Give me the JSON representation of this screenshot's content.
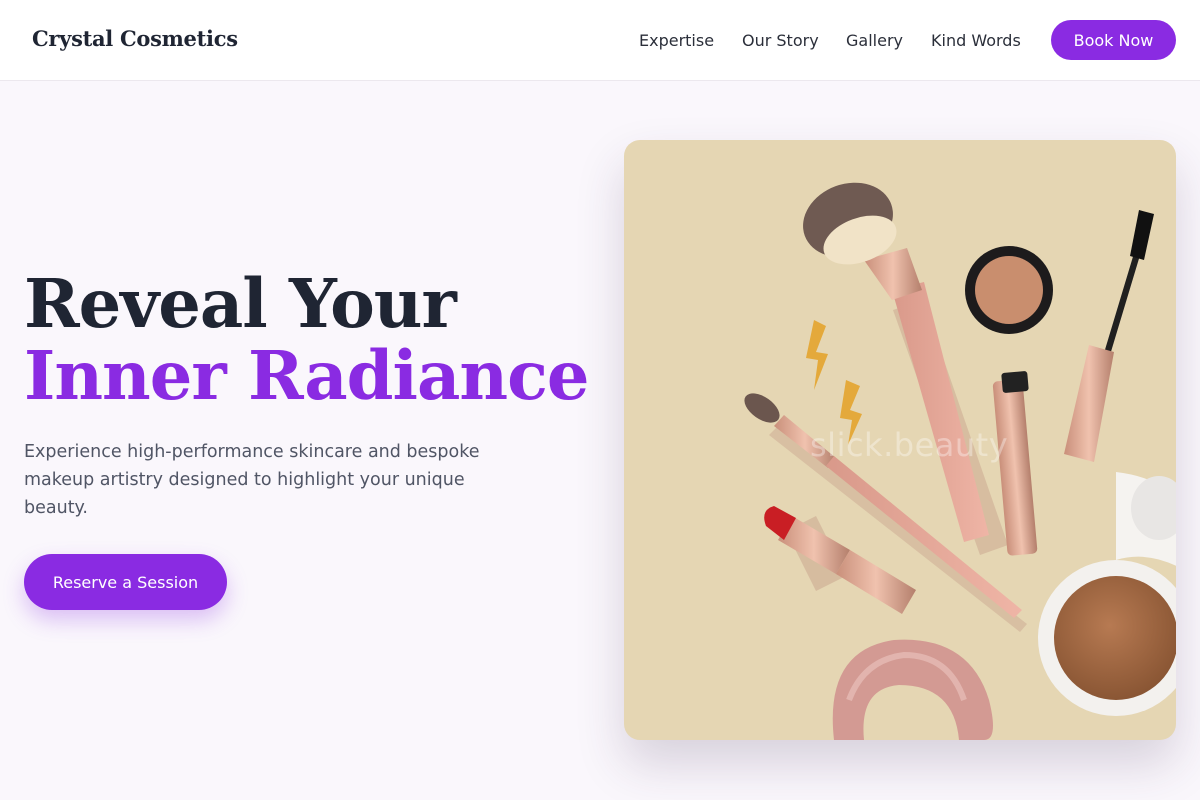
{
  "brand": {
    "name": "Crystal Cosmetics"
  },
  "nav": {
    "items": [
      {
        "label": "Expertise"
      },
      {
        "label": "Our Story"
      },
      {
        "label": "Gallery"
      },
      {
        "label": "Kind Words"
      }
    ],
    "book_label": "Book Now"
  },
  "hero": {
    "title_part1": "Reveal Your ",
    "title_accent": "Inner Radiance",
    "subtitle": "Experience high-performance skincare and bespoke makeup artistry designed to highlight your unique beauty.",
    "cta_label": "Reserve a Session",
    "image_watermark": "slick.beauty"
  },
  "colors": {
    "accent": "#8a2be2",
    "heading": "#1f2533",
    "image_background": "#e5d6b3"
  }
}
